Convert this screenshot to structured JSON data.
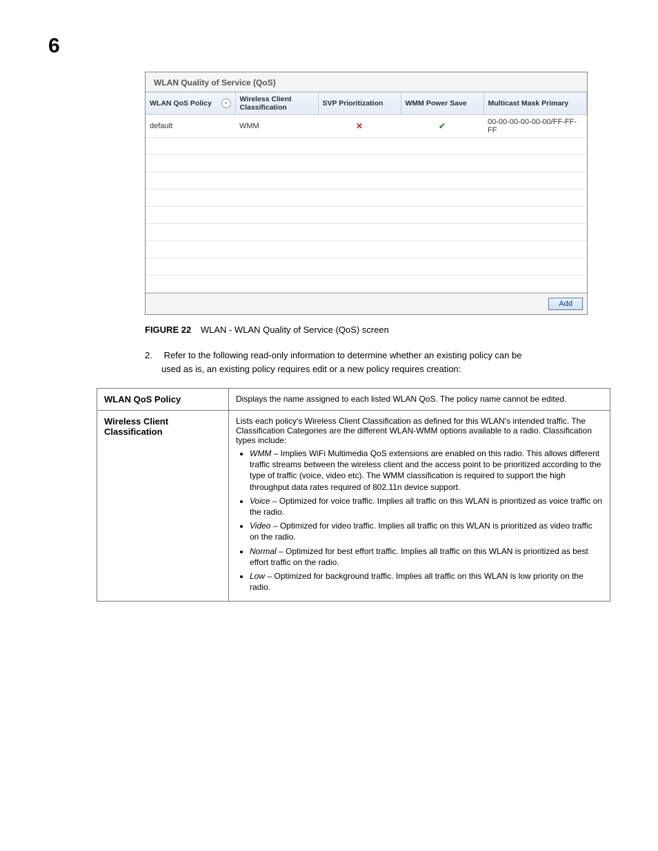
{
  "page_number": "6",
  "panel": {
    "title": "WLAN Quality of Service (QoS)",
    "columns": [
      "WLAN QoS Policy",
      "Wireless Client Classification",
      "SVP Prioritization",
      "WMM Power Save",
      "Multicast Mask Primary"
    ],
    "row": {
      "policy": "default",
      "classification": "WMM",
      "multicast": "00-00-00-00-00-00/FF-FF-FF"
    },
    "add_label": "Add"
  },
  "figure": {
    "num": "FIGURE 22",
    "caption": "WLAN - WLAN Quality of Service (QoS) screen"
  },
  "step": {
    "num": "2.",
    "text1": "Refer to the following read-only information to determine whether an existing policy can be",
    "text2": "used as is, an existing policy requires edit or a new policy requires creation:"
  },
  "info": {
    "r1_label": "WLAN QoS Policy",
    "r1_text": "Displays the name assigned to each listed WLAN QoS. The policy name cannot be edited.",
    "r2_label": "Wireless Client Classification",
    "r2_intro": "Lists each policy's Wireless Client Classification as defined for this WLAN's intended traffic. The Classification Categories are the different WLAN-WMM options available to a radio. Classification types include:",
    "r2_items": [
      {
        "term": "WMM",
        "text": " – Implies WiFi Multimedia QoS extensions are enabled on this radio. This allows different traffic streams between the wireless client and the access point to be prioritized according to the type of traffic (voice, video etc). The WMM classification is required to support the high throughput data rates required of 802.11n device support."
      },
      {
        "term": "Voice",
        "text": " – Optimized for voice traffic. Implies all traffic on this WLAN is prioritized as voice traffic on the radio."
      },
      {
        "term": "Video",
        "text": " – Optimized for video traffic. Implies all traffic on this WLAN is prioritized as video traffic on the radio."
      },
      {
        "term": "Normal",
        "text": " – Optimized for best effort traffic. Implies all traffic on this WLAN is prioritized as best effort traffic on the radio."
      },
      {
        "term": "Low",
        "text": " – Optimized for background traffic. Implies all traffic on this WLAN is low priority on the radio."
      }
    ]
  }
}
